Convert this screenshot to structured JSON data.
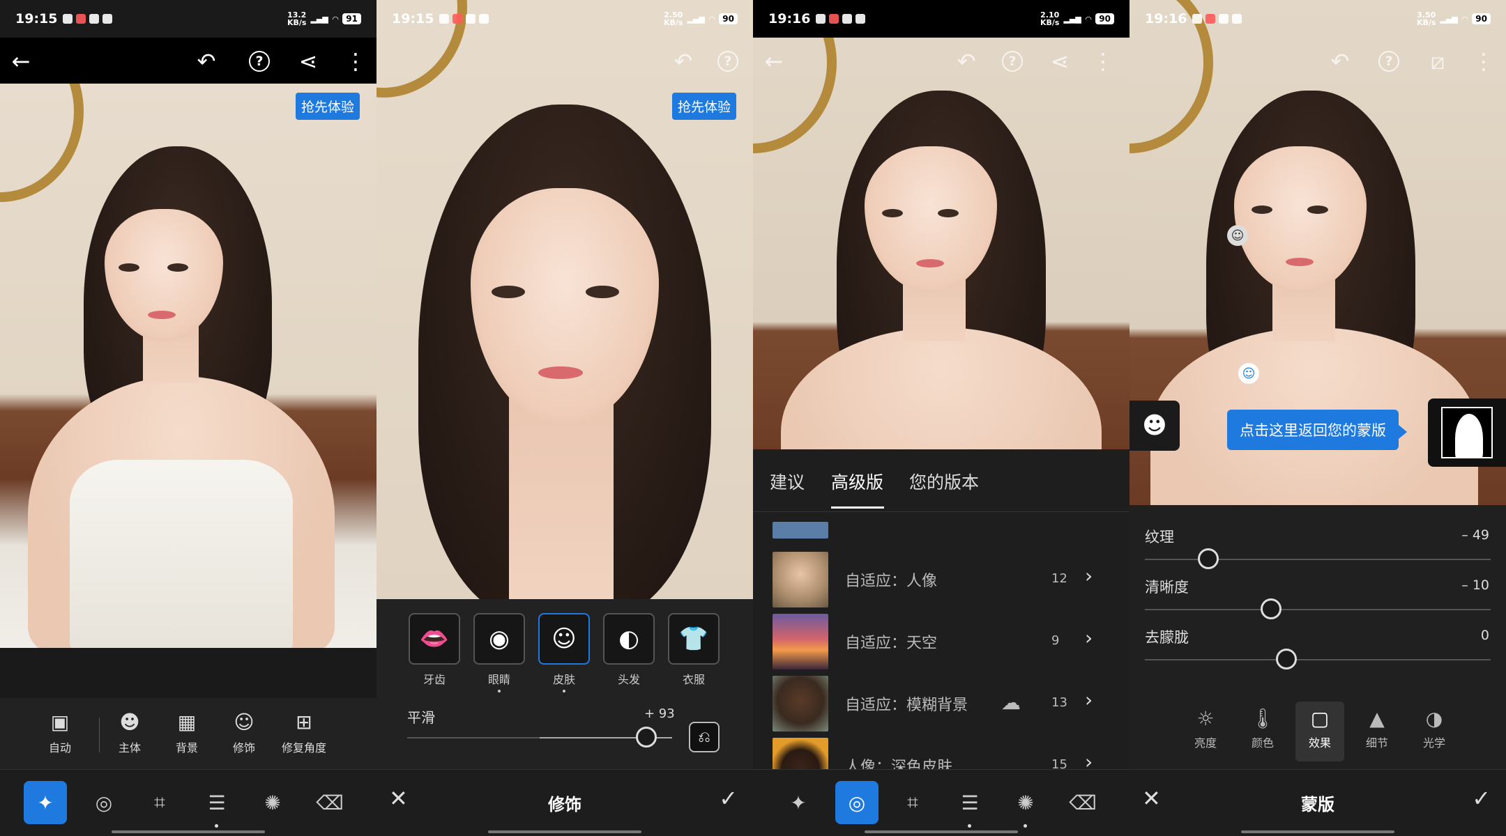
{
  "panels": [
    {
      "status": {
        "time": "19:15",
        "speed": "13.2\nKB/s",
        "battery": "91"
      },
      "early_access": "抢先体验",
      "subtools": [
        {
          "icon": "auto-photo-icon",
          "label": "自动"
        },
        {
          "icon": "subject-icon",
          "label": "主体"
        },
        {
          "icon": "background-icon",
          "label": "背景"
        },
        {
          "icon": "retouch-face-icon",
          "label": "修饰"
        },
        {
          "icon": "perspective-icon",
          "label": "修复角度"
        }
      ]
    },
    {
      "status": {
        "time": "19:15",
        "speed": "2.50\nKB/s",
        "battery": "90"
      },
      "early_access": "抢先体验",
      "features": [
        {
          "icon": "lips-icon",
          "label": "牙齿"
        },
        {
          "icon": "eye-icon",
          "label": "眼睛"
        },
        {
          "icon": "face-icon",
          "label": "皮肤"
        },
        {
          "icon": "hair-icon",
          "label": "头发"
        },
        {
          "icon": "shirt-icon",
          "label": "衣服"
        }
      ],
      "slider": {
        "label": "平滑",
        "value": "+ 93",
        "level": 0.93
      },
      "title": "修饰"
    },
    {
      "status": {
        "time": "19:16",
        "speed": "2.10\nKB/s",
        "battery": "90"
      },
      "tabs": [
        "建议",
        "高级版",
        "您的版本"
      ],
      "presets": [
        {
          "name": "自适应：人像",
          "count": "12",
          "thumb": "#7a6a55"
        },
        {
          "name": "自适应：天空",
          "count": "9",
          "thumb": "#c9504a"
        },
        {
          "name": "自适应：模糊背景",
          "count": "13",
          "thumb": "#4a3a2e",
          "cloud": true
        },
        {
          "name": "人像：深色皮肤",
          "count": "15",
          "thumb": "#e39b2a"
        }
      ]
    },
    {
      "status": {
        "time": "19:16",
        "speed": "3.50\nKB/s",
        "battery": "90"
      },
      "tooltip": "点击这里返回您的蒙版",
      "sliders": [
        {
          "label": "纹理",
          "value": "– 49",
          "level": 0.255
        },
        {
          "label": "清晰度",
          "value": "– 10",
          "level": 0.45
        },
        {
          "label": "去朦胧",
          "value": "0",
          "level": 0.5
        }
      ],
      "categories": [
        {
          "icon": "sun-icon",
          "label": "亮度"
        },
        {
          "icon": "thermometer-icon",
          "label": "颜色"
        },
        {
          "icon": "effects-icon",
          "label": "效果"
        },
        {
          "icon": "detail-icon",
          "label": "细节"
        },
        {
          "icon": "optics-icon",
          "label": "光学"
        }
      ],
      "title": "蒙版"
    }
  ]
}
